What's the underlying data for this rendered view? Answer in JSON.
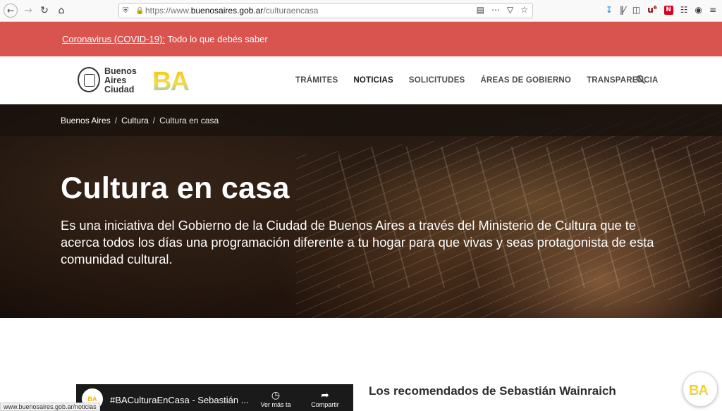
{
  "browser": {
    "url_scheme": "https://www.",
    "url_host": "buenosaires.gob.ar",
    "url_path": "/culturaencasa",
    "ublock_count": "6"
  },
  "covid_banner": {
    "link_text": "Coronavirus (COVID-19):",
    "text": " Todo lo que debés saber"
  },
  "header": {
    "logo_lines": [
      "Buenos",
      "Aires",
      "Ciudad"
    ],
    "ba_logo_text": "BA",
    "nav": [
      "TRÁMITES",
      "NOTICIAS",
      "SOLICITUDES",
      "ÁREAS DE GOBIERNO",
      "TRANSPARENCIA"
    ],
    "active_nav": "NOTICIAS"
  },
  "breadcrumb": {
    "items": [
      "Buenos Aires",
      "Cultura",
      "Cultura en casa"
    ],
    "separator": "/"
  },
  "hero": {
    "title": "Cultura en casa",
    "description": "Es una iniciativa del Gobierno de la Ciudad de Buenos Aires a través del Ministerio de Cultura que te acerca todos los días una programación diferente a tu hogar para que vivas y seas protagonista de esta comunidad cultural."
  },
  "video": {
    "channel_badge": "BA",
    "title": "#BACulturaEnCasa - Sebastián ...",
    "watch_later": "Ver más ta",
    "share": "Compartir"
  },
  "recommended": {
    "heading": "Los recomendados de Sebastián Wainraich"
  },
  "status_bar": {
    "url": "www.buenosaires.gob.ar/noticias"
  },
  "chat": {
    "badge": "BA"
  },
  "colors": {
    "banner_red": "#d9534f",
    "ba_yellow": "#f5c400",
    "ba_blue": "#6ec6e6"
  }
}
